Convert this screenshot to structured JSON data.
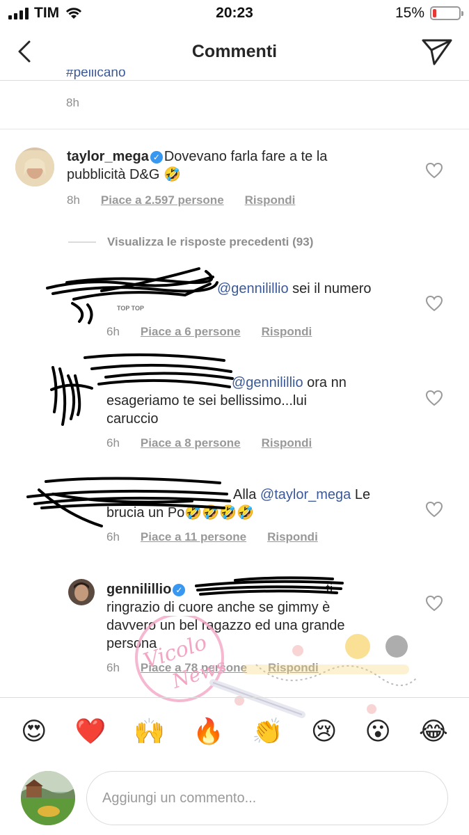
{
  "status": {
    "carrier": "TIM",
    "time": "20:23",
    "battery": "15%",
    "battery_level": 0.15
  },
  "nav": {
    "title": "Commenti"
  },
  "top": {
    "fragment": "#pellicano",
    "time": "8h"
  },
  "comments": [
    {
      "username": "taylor_mega",
      "verified": true,
      "text_1": "Dovevano farla fare a te la",
      "text_2": "pubblicità D&G 🤣",
      "time": "8h",
      "likes": "Piace a 2.597 persone",
      "reply": "Rispondi"
    }
  ],
  "view_previous": "Visualizza le risposte precedenti (93)",
  "replies": [
    {
      "mention": "@gennilillio",
      "text": " sei il numero",
      "badge": "TOP TOP",
      "time": "6h",
      "likes": "Piace a 6 persone",
      "reply": "Rispondi"
    },
    {
      "mention": "@gennilillio",
      "text_1": " ora nn",
      "text_2": "esageriamo te sei bellissimo...lui",
      "text_3": "caruccio",
      "time": "6h",
      "likes": "Piace a 8 persone",
      "reply": "Rispondi"
    },
    {
      "prefix": "Alla ",
      "mention": "@taylor_mega",
      "text_1": " Le",
      "text_2": "brucia un Po🤣🤣🤣🤣",
      "time": "6h",
      "likes": "Piace a 11 persone",
      "reply": "Rispondi"
    },
    {
      "username": "gennilillio",
      "verified": true,
      "text_1": "ti",
      "text_2": "ringrazio di cuore anche se gimmy è",
      "text_3": "davvero un bel ragazzo ed una grande",
      "text_4": "persona",
      "time": "6h",
      "likes": "Piace a 78 persone",
      "reply": "Rispondi"
    }
  ],
  "emoji_bar": [
    "😍",
    "❤️",
    "🙌",
    "🔥",
    "👏",
    "😢",
    "😮",
    "😂"
  ],
  "input": {
    "placeholder": "Aggiungi un commento..."
  },
  "watermark": {
    "text_1": "Vicolo",
    "text_2": "News"
  },
  "colors": {
    "mention": "#3b5998",
    "verified": "#3897f0",
    "battery_low": "#e53935"
  }
}
